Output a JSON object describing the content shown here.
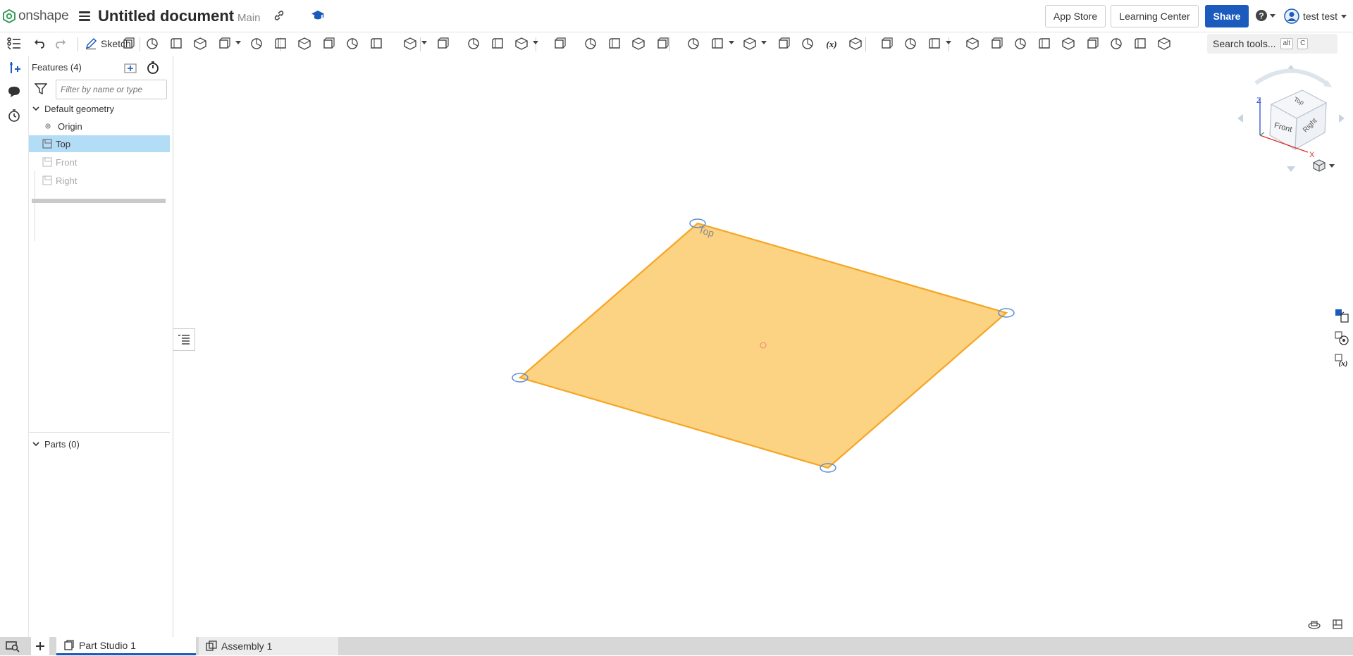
{
  "header": {
    "logo_text": "onshape",
    "doc_title": "Untitled document",
    "branch": "Main",
    "app_store": "App Store",
    "learning_center": "Learning Center",
    "share": "Share",
    "user_name": "test test"
  },
  "toolbar": {
    "sketch_label": "Sketch",
    "search_label": "Search tools...",
    "shortcut_alt": "alt",
    "shortcut_key": "C"
  },
  "features": {
    "header": "Features (4)",
    "filter_placeholder": "Filter by name or type",
    "group_label": "Default geometry",
    "items": [
      {
        "label": "Origin"
      },
      {
        "label": "Top"
      },
      {
        "label": "Front"
      },
      {
        "label": "Right"
      }
    ],
    "parts_label": "Parts (0)"
  },
  "viewport": {
    "plane_label": "Top",
    "navcube": {
      "top": "Top",
      "front": "Front",
      "right": "Right",
      "axis_x": "X",
      "axis_z": "Z"
    }
  },
  "tabs": [
    {
      "label": "Part Studio 1"
    },
    {
      "label": "Assembly 1"
    }
  ],
  "colors": {
    "accent": "#1a5bbd",
    "plane_fill": "#fcd283",
    "plane_edge": "#f5a623",
    "selection": "#b3dcf6"
  }
}
